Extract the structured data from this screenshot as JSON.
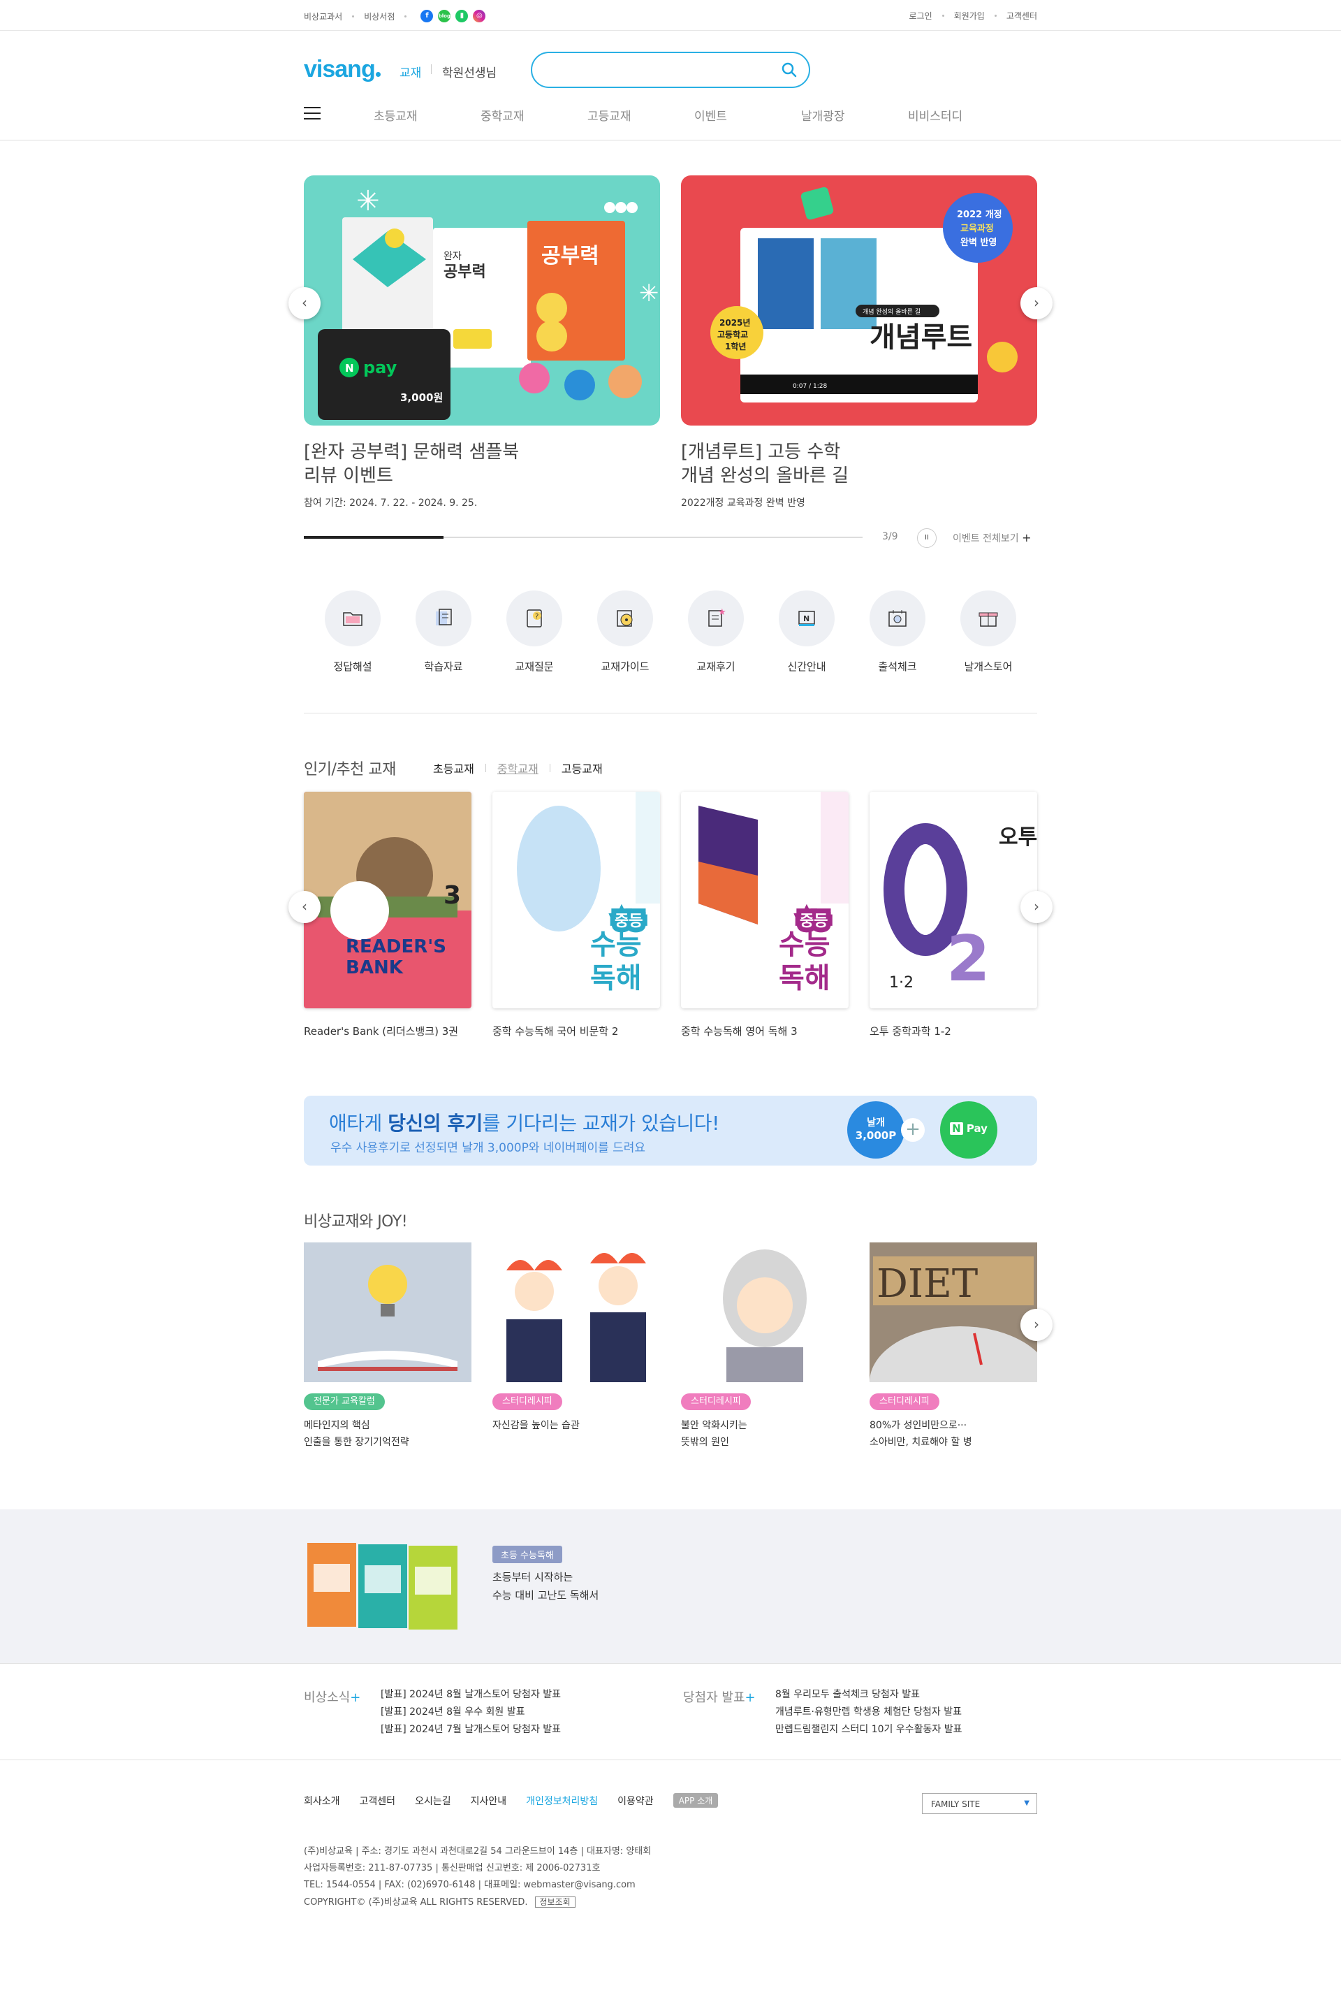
{
  "util": {
    "links_left": [
      "비상교과서",
      "비상서점"
    ],
    "links_right": [
      "로그인",
      "회원가입",
      "고객센터"
    ]
  },
  "header": {
    "logo": "visang",
    "tab_active": "교재",
    "tab_inactive": "학원선생님",
    "search_placeholder": ""
  },
  "gnb": [
    "초등교재",
    "중학교재",
    "고등교재",
    "이벤트",
    "날개광장",
    "비비스터디"
  ],
  "banners": [
    {
      "title_1": "[완자 공부력] 문해력 샘플북",
      "title_2": "리뷰 이벤트",
      "sub": "참여 기간: 2024. 7. 22. - 2024. 9. 25.",
      "art_title": "공부력",
      "art_brand": "완자",
      "art_pay": "pay",
      "art_amount": "3,000원"
    },
    {
      "title_1": "[개념루트] 고등 수학",
      "title_2": "개념 완성의 올바른 길",
      "sub": "2022개정 교육과정 완벽 반영",
      "art_title": "개념루트",
      "art_badge_1": "2022 개정",
      "art_badge_2": "교육과정",
      "art_badge_3": "완벽 반영",
      "art_yellow_1": "2025년",
      "art_yellow_2": "고등학교",
      "art_yellow_3": "1학년",
      "art_caption": "개념 완성의 올바른 길",
      "art_time": "0:07 / 1:28"
    }
  ],
  "slider": {
    "pager": "3/9",
    "pause": "II",
    "all_events": "이벤트 전체보기"
  },
  "quick_menu": [
    "정답해설",
    "학습자료",
    "교재질문",
    "교재가이드",
    "교재후기",
    "신간안내",
    "출석체크",
    "날개스토어"
  ],
  "popular": {
    "title": "인기/추천 교재",
    "tabs": [
      "초등교재",
      "중학교재",
      "고등교재"
    ],
    "books": [
      {
        "name": "Reader's Bank (리더스뱅크) 3권",
        "cover_1": "READER'S",
        "cover_2": "BANK",
        "cover_num": "3",
        "color": "#e8566e"
      },
      {
        "name": "중학 수능독해 국어 비문학 2",
        "cover_1": "중등",
        "cover_2": "수능",
        "cover_3": "독해",
        "color": "#2aa9c8"
      },
      {
        "name": "중학 수능독해 영어 독해 3",
        "cover_1": "중등",
        "cover_2": "수능",
        "cover_3": "독해",
        "color": "#a32a8a"
      },
      {
        "name": "오투 중학과학 1-2",
        "cover_1": "오투",
        "cover_2": "1·2",
        "color": "#5a3f9a"
      }
    ]
  },
  "review": {
    "headline_pre": "애타게 ",
    "headline_bold": "당신의 후기",
    "headline_post": "를 기다리는 교재가 있습니다!",
    "sub": "우수 사용후기로 선정되면 날개 3,000P와 네이버페이를 드려요",
    "coin_1": "날개",
    "coin_2": "3,000P",
    "plus": "+",
    "npay": "Pay"
  },
  "joy": {
    "title": "비상교재와 JOY!",
    "items": [
      {
        "tag": "전문가 교육칼럼",
        "tag_color": "#53c48e",
        "line1": "메타인지의 핵심",
        "line2": "인출을 통한 장기기억전략"
      },
      {
        "tag": "스터디레시피",
        "tag_color": "#f07dbe",
        "line1": "자신감을 높이는 습관",
        "line2": ""
      },
      {
        "tag": "스터디레시피",
        "tag_color": "#f07dbe",
        "line1": "불안 악화시키는",
        "line2": "뜻밖의 원인"
      },
      {
        "tag": "스터디레시피",
        "tag_color": "#f07dbe",
        "line1": "80%가 성인비만으로···",
        "line2": "소아비만, 치료해야 할 병"
      }
    ],
    "diet": "DIET"
  },
  "band": {
    "tag": "초등 수능독해",
    "line1": "초등부터 시작하는",
    "line2": "수능 대비 고난도 독해서"
  },
  "news": {
    "title": "비상소식",
    "items": [
      "[발표] 2024년 8월 날개스토어 당첨자 발표",
      "[발표] 2024년 8월 우수 회원 발표",
      "[발표] 2024년 7월 날개스토어 당첨자 발표"
    ],
    "win_title": "당첨자 발표",
    "win_items": [
      "8월 우리모두 출석체크 당첨자 발표",
      "개념루트·유형만렙 학생용 체험단 당첨자 발표",
      "만렙드림챌린지 스터디 10기 우수활동자 발표"
    ],
    "plus": "+"
  },
  "footer": {
    "links": [
      "회사소개",
      "고객센터",
      "오시는길",
      "지사안내",
      "개인정보처리방침",
      "이용약관"
    ],
    "app": "APP 소개",
    "family": "FAMILY SITE",
    "info_1": "(주)비상교육 | 주소: 경기도 과천시 과천대로2길 54 그라운드브이 14층 | 대표자명: 양태회",
    "info_2": "사업자등록번호: 211-87-07735 | 통신판매업 신고번호: 제 2006-02731호",
    "info_3": "TEL: 1544-0554 | FAX: (02)6970-6148 | 대표메일: webmaster@visang.com",
    "info_4": "COPYRIGHT© (주)비상교육 ALL RIGHTS RESERVED.",
    "info_btn": "정보조회"
  }
}
